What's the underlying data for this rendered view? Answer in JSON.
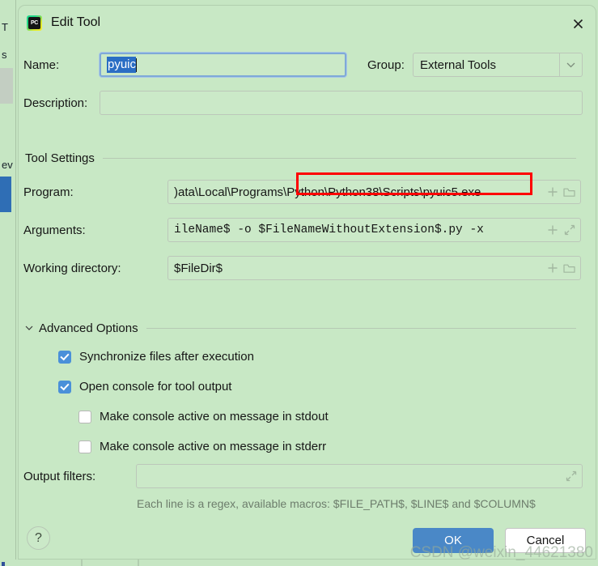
{
  "window": {
    "title": "Edit Tool",
    "app_icon": "pycharm-icon",
    "app_icon_text": "PC",
    "close_icon": "close-icon"
  },
  "form": {
    "name_label": "Name:",
    "name_value": "pyuic",
    "group_label": "Group:",
    "group_value": "External Tools",
    "group_options": [
      "External Tools"
    ],
    "description_label": "Description:",
    "description_value": ""
  },
  "tool_settings": {
    "section_title": "Tool Settings",
    "program_label": "Program:",
    "program_value": ")ata\\Local\\Programs\\Python\\Python38\\Scripts\\pyuic5.exe",
    "program_highlight": "Python\\Python38\\Scripts\\pyuic5.exe",
    "program_prefix": ")ata\\Local\\Programs\\",
    "arguments_label": "Arguments:",
    "arguments_value": "ileName$ -o $FileNameWithoutExtension$.py -x",
    "working_directory_label": "Working directory:",
    "working_directory_value": "$FileDir$",
    "insert_macro_icon": "plus-icon",
    "browse_icon": "folder-icon",
    "expand_icon": "expand-arrows-icon"
  },
  "advanced_options": {
    "section_title": "Advanced Options",
    "collapse_icon": "chevron-down-icon",
    "items": [
      {
        "label": "Synchronize files after execution",
        "checked": true,
        "indent": 0
      },
      {
        "label": "Open console for tool output",
        "checked": true,
        "indent": 0
      },
      {
        "label": "Make console active on message in stdout",
        "checked": false,
        "indent": 1
      },
      {
        "label": "Make console active on message in stderr",
        "checked": false,
        "indent": 1
      }
    ]
  },
  "output_filters": {
    "label": "Output filters:",
    "value": "",
    "expand_icon": "expand-arrows-icon",
    "hint": "Each line is a regex, available macros: $FILE_PATH$, $LINE$ and $COLUMN$"
  },
  "footer": {
    "help_label": "?",
    "ok_label": "OK",
    "cancel_label": "Cancel"
  },
  "annotation": {
    "highlight_color": "#ff0000"
  },
  "watermark": {
    "text": "CSDN @weixin_44621380"
  },
  "background_fragments": {
    "f1": "T",
    "f2": "s",
    "f3": "ev"
  },
  "colors": {
    "dialog_background": "#c8e8c5",
    "primary_button": "#4a88c7",
    "checkbox_checked": "#4a90d9",
    "selection": "#2a6ec4"
  }
}
